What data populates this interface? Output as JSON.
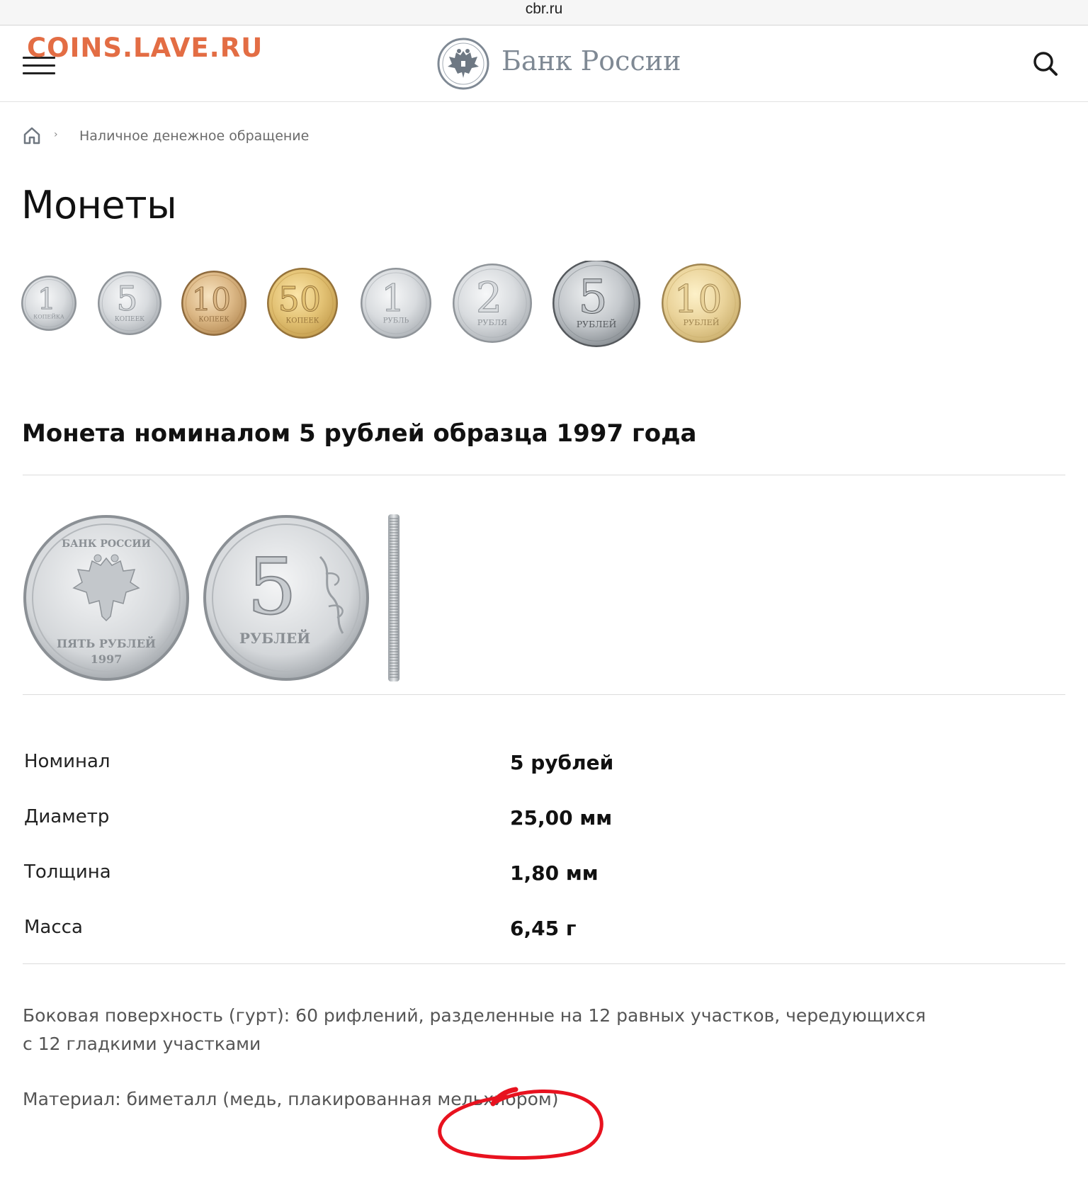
{
  "browser": {
    "domain": "cbr.ru"
  },
  "watermark": "COINS.LAVE.RU",
  "header": {
    "logo_text": "Банк России"
  },
  "breadcrumb": {
    "separator": "›",
    "link": "Наличное денежное обращение"
  },
  "page_title": "Монеты",
  "coin_row": [
    {
      "denomination": "1",
      "sub": "КОПЕЙКА",
      "metal": "silver"
    },
    {
      "denomination": "5",
      "sub": "КОПЕЕК",
      "metal": "silver"
    },
    {
      "denomination": "10",
      "sub": "КОПЕЕК",
      "metal": "brass"
    },
    {
      "denomination": "50",
      "sub": "КОПЕЕК",
      "metal": "gold"
    },
    {
      "denomination": "1",
      "sub": "РУБЛЬ",
      "metal": "silver"
    },
    {
      "denomination": "2",
      "sub": "РУБЛЯ",
      "metal": "silver"
    },
    {
      "denomination": "5",
      "sub": "РУБЛЕЙ",
      "metal": "silver-dark"
    },
    {
      "denomination": "10",
      "sub": "РУБЛЕЙ",
      "metal": "gold-light"
    }
  ],
  "coin_heading": "Монета номиналом 5 рублей образца 1997 года",
  "coin_images": {
    "obverse": {
      "top_text": "БАНК РОССИИ",
      "bottom_text": "ПЯТЬ РУБЛЕЙ",
      "year": "1997"
    },
    "reverse": {
      "denomination": "5",
      "sub": "РУБЛЕЙ"
    }
  },
  "specs": [
    {
      "label": "Номинал",
      "value": "5 рублей"
    },
    {
      "label": "Диаметр",
      "value": "25,00 мм"
    },
    {
      "label": "Толщина",
      "value": "1,80 мм"
    },
    {
      "label": "Масса",
      "value": "6,45 г"
    }
  ],
  "description": {
    "edge_line1": "Боковая поверхность (гурт): 60 рифлений, разделенные на 12 равных участков, чередующихся",
    "edge_line2": "с 12 гладкими участками",
    "material": "Материал: биметалл (медь, плакированная мельхиором)"
  },
  "colors": {
    "watermark": "#e05a2b",
    "annotation_circle": "#e8121f",
    "logo_text": "#7f8994"
  }
}
